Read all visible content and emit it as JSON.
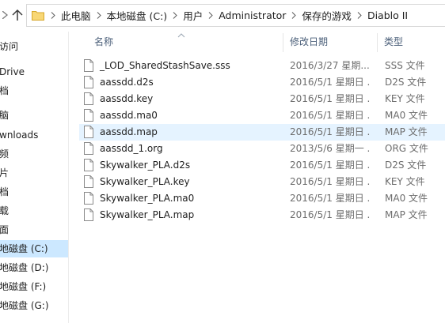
{
  "breadcrumbs": [
    "此电脑",
    "本地磁盘 (C:)",
    "用户",
    "Administrator",
    "保存的游戏",
    "Diablo II"
  ],
  "sidebar": {
    "items": [
      {
        "label": "访问",
        "selected": false
      },
      {
        "label": "Drive",
        "selected": false
      },
      {
        "label": "档",
        "selected": false
      },
      {
        "label": "脑",
        "selected": false
      },
      {
        "label": "wnloads",
        "selected": false
      },
      {
        "label": "频",
        "selected": false
      },
      {
        "label": "片",
        "selected": false
      },
      {
        "label": "档",
        "selected": false
      },
      {
        "label": "载",
        "selected": false
      },
      {
        "label": "面",
        "selected": false
      },
      {
        "label": "地磁盘 (C:)",
        "selected": true
      },
      {
        "label": "地磁盘 (D:)",
        "selected": false
      },
      {
        "label": "地磁盘 (F:)",
        "selected": false
      },
      {
        "label": "地磁盘 (G:)",
        "selected": false
      }
    ]
  },
  "columns": {
    "name": "名称",
    "date": "修改日期",
    "type": "类型"
  },
  "files": [
    {
      "name": "_LOD_SharedStashSave.sss",
      "date": "2016/3/27 星期...",
      "type": "SSS 文件",
      "hover": false
    },
    {
      "name": "aassdd.d2s",
      "date": "2016/5/1 星期日 ...",
      "type": "D2S 文件",
      "hover": false
    },
    {
      "name": "aassdd.key",
      "date": "2016/5/1 星期日 ...",
      "type": "KEY 文件",
      "hover": false
    },
    {
      "name": "aassdd.ma0",
      "date": "2016/5/1 星期日 ...",
      "type": "MA0 文件",
      "hover": false
    },
    {
      "name": "aassdd.map",
      "date": "2016/5/1 星期日 ...",
      "type": "MAP 文件",
      "hover": true
    },
    {
      "name": "aassdd_1.org",
      "date": "2013/5/6 星期一 ...",
      "type": "ORG 文件",
      "hover": false
    },
    {
      "name": "Skywalker_PLA.d2s",
      "date": "2016/5/1 星期日 ...",
      "type": "D2S 文件",
      "hover": false
    },
    {
      "name": "Skywalker_PLA.key",
      "date": "2016/5/1 星期日 ...",
      "type": "KEY 文件",
      "hover": false
    },
    {
      "name": "Skywalker_PLA.ma0",
      "date": "2016/5/1 星期日 ...",
      "type": "MA0 文件",
      "hover": false
    },
    {
      "name": "Skywalker_PLA.map",
      "date": "2016/5/1 星期日 ...",
      "type": "MAP 文件",
      "hover": false
    }
  ],
  "colors": {
    "selection": "#cce8ff",
    "hover": "#e5f3ff",
    "header_text": "#4c607a",
    "folder": "#f8d775"
  }
}
